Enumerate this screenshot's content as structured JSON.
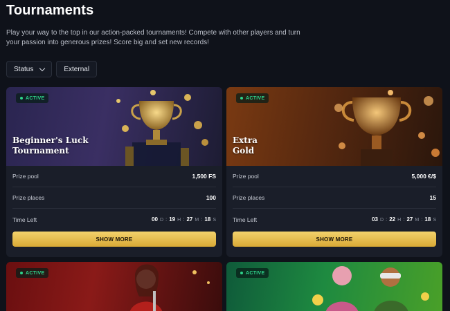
{
  "page": {
    "title": "Tournaments",
    "description": "Play your way to the top in our action-packed tournaments! Compete with other players and turn your passion into generous prizes! Score big and set new records!"
  },
  "filters": {
    "status_label": "Status",
    "external_label": "External"
  },
  "cards": [
    {
      "badge": "ACTIVE",
      "title_line1": "Beginner's Luck",
      "title_line2": "Tournament",
      "prize_pool_label": "Prize pool",
      "prize_pool_value": "1,500 FS",
      "prize_places_label": "Prize places",
      "prize_places_value": "100",
      "time_left_label": "Time Left",
      "timer": {
        "d": "00",
        "h": "19",
        "m": "27",
        "s": "18"
      },
      "button_label": "SHOW MORE"
    },
    {
      "badge": "ACTIVE",
      "title_line1": "Extra",
      "title_line2": "Gold",
      "prize_pool_label": "Prize pool",
      "prize_pool_value": "5,000 €/$",
      "prize_places_label": "Prize places",
      "prize_places_value": "15",
      "time_left_label": "Time Left",
      "timer": {
        "d": "03",
        "h": "22",
        "m": "27",
        "s": "18"
      },
      "button_label": "SHOW MORE"
    },
    {
      "badge": "ACTIVE"
    },
    {
      "badge": "ACTIVE"
    }
  ],
  "timer_units": {
    "d": "D",
    "h": "H",
    "m": "M",
    "s": "S",
    "sep": ":"
  },
  "colors": {
    "background": "#0f121a",
    "card": "#1a1e29",
    "accent_gold": "#e6bd4c",
    "active_green": "#2fd38b"
  }
}
